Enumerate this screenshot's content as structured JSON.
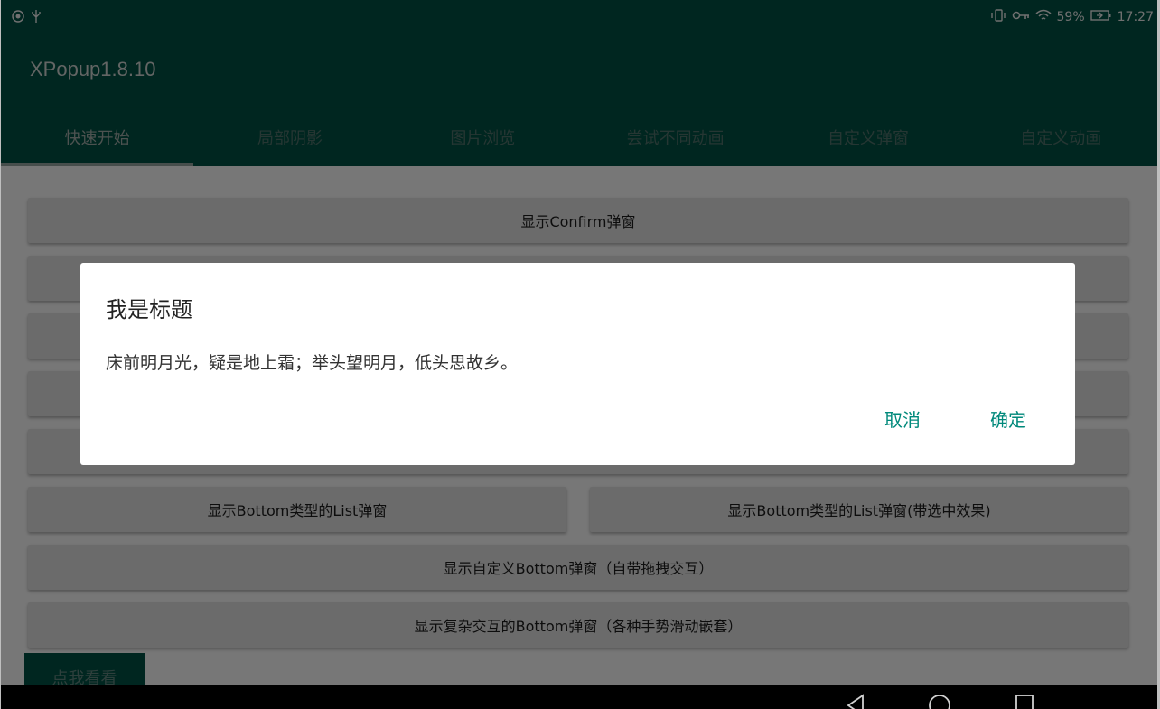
{
  "status_bar": {
    "left_icons": [
      "nfc-icon",
      "usb-icon"
    ],
    "right_icons": [
      "vibrate-icon",
      "vpn-key-icon",
      "wifi-icon"
    ],
    "battery": "59%",
    "time": "17:27"
  },
  "app_bar": {
    "title": "XPopup1.8.10"
  },
  "tabs": [
    {
      "label": "快速开始",
      "active": true
    },
    {
      "label": "局部阴影"
    },
    {
      "label": "图片浏览"
    },
    {
      "label": "尝试不同动画"
    },
    {
      "label": "自定义弹窗"
    },
    {
      "label": "自定义动画"
    }
  ],
  "buttons": {
    "confirm_popup": "显示Confirm弹窗",
    "bottom_list": "显示Bottom类型的List弹窗",
    "bottom_list_checked": "显示Bottom类型的List弹窗(带选中效果)",
    "custom_bottom": "显示自定义Bottom弹窗（自带拖拽交互）",
    "complex_bottom": "显示复杂交互的Bottom弹窗（各种手势滑动嵌套）",
    "look_button": "点我看看"
  },
  "dialog": {
    "title": "我是标题",
    "message": "床前明月光，疑是地上霜；举头望明月，低头思故乡。",
    "cancel_label": "取消",
    "confirm_label": "确定"
  },
  "colors": {
    "primary_dark": "#004d40",
    "accent": "#00897b"
  }
}
